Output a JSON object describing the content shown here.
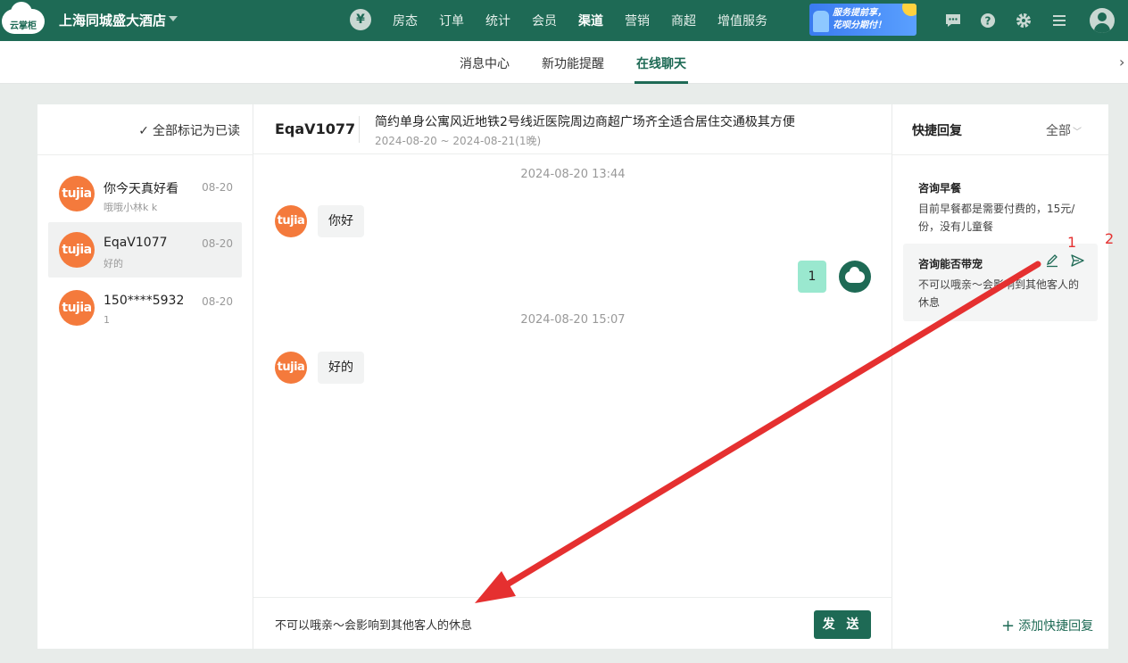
{
  "brand": {
    "logo_text": "云掌柜",
    "hotel_name": "上海同城盛大酒店"
  },
  "nav": {
    "items": [
      "房态",
      "订单",
      "统计",
      "会员",
      "渠道",
      "营销",
      "商超",
      "增值服务"
    ],
    "active": "渠道",
    "promo_line1": "服务提前享，",
    "promo_line2": "花呗分期付！"
  },
  "tabs": {
    "items": [
      "消息中心",
      "新功能提醒",
      "在线聊天"
    ],
    "active": "在线聊天"
  },
  "left": {
    "mark_all_read": "全部标记为已读",
    "conversations": [
      {
        "name": "你今天真好看",
        "date": "08-20",
        "preview": "哦哦小林k k",
        "avatar": "tujia"
      },
      {
        "name": "EqaV1077",
        "date": "08-20",
        "preview": "好的",
        "avatar": "tujia"
      },
      {
        "name": "150****5932",
        "date": "08-20",
        "preview": "1",
        "avatar": "tujia"
      }
    ]
  },
  "chat": {
    "user": "EqaV1077",
    "listing_title": "简约单身公寓风近地铁2号线近医院周边商超广场齐全适合居住交通极其方便",
    "stay_dates": "2024-08-20 ~ 2024-08-21(1晚)",
    "timestamp1": "2024-08-20 13:44",
    "msg1": "你好",
    "msg2": "1",
    "timestamp2": "2024-08-20 15:07",
    "msg3": "好的",
    "composer_text": "不可以哦亲～会影响到其他客人的休息",
    "send_label": "发 送"
  },
  "quick_reply": {
    "title": "快捷回复",
    "filter": "全部",
    "items": [
      {
        "title": "咨询早餐",
        "text": "目前早餐都是需要付费的，15元/份，没有儿童餐"
      },
      {
        "title": "咨询能否带宠",
        "text": "不可以哦亲～会影响到其他客人的休息"
      }
    ],
    "annotation1": "1",
    "annotation2": "2",
    "add_label": "添加快捷回复"
  },
  "colors": {
    "brand_green": "#1e6a55",
    "tujia_orange": "#f47a3c",
    "annotation_red": "#e53030"
  }
}
